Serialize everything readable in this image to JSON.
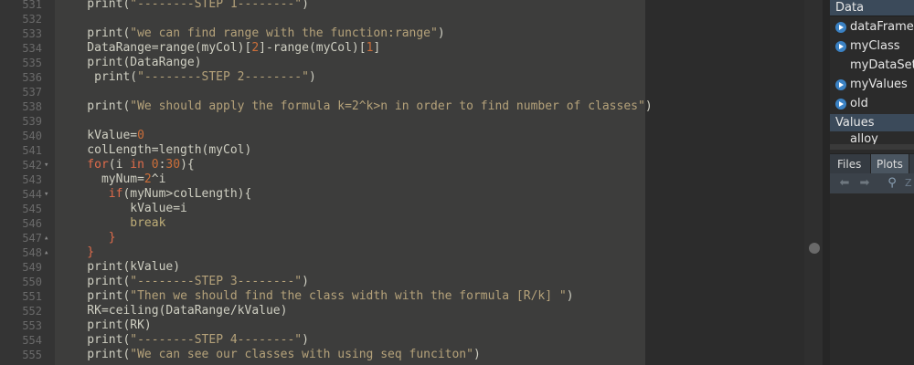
{
  "editor": {
    "lines": [
      {
        "num": "531",
        "fold": "",
        "segs": [
          {
            "c": "t",
            "x": "    print("
          },
          {
            "c": "s",
            "x": "\"--------STEP 1--------\""
          },
          {
            "c": "t",
            "x": ")"
          }
        ]
      },
      {
        "num": "532",
        "fold": "",
        "segs": []
      },
      {
        "num": "533",
        "fold": "",
        "segs": [
          {
            "c": "t",
            "x": "    print("
          },
          {
            "c": "s",
            "x": "\"we can find range with the function:range\""
          },
          {
            "c": "t",
            "x": ")"
          }
        ]
      },
      {
        "num": "534",
        "fold": "",
        "segs": [
          {
            "c": "t",
            "x": "    DataRange=range(myCol)["
          },
          {
            "c": "n",
            "x": "2"
          },
          {
            "c": "t",
            "x": "]-range(myCol)["
          },
          {
            "c": "n",
            "x": "1"
          },
          {
            "c": "t",
            "x": "]"
          }
        ]
      },
      {
        "num": "535",
        "fold": "",
        "segs": [
          {
            "c": "t",
            "x": "    print(DataRange)"
          }
        ]
      },
      {
        "num": "536",
        "fold": "",
        "segs": [
          {
            "c": "t",
            "x": "     print("
          },
          {
            "c": "s",
            "x": "\"--------STEP 2--------\""
          },
          {
            "c": "t",
            "x": ")"
          }
        ]
      },
      {
        "num": "537",
        "fold": "",
        "segs": []
      },
      {
        "num": "538",
        "fold": "",
        "segs": [
          {
            "c": "t",
            "x": "    print("
          },
          {
            "c": "s",
            "x": "\"We should apply the formula k=2^k>n in order to find number of classes\""
          },
          {
            "c": "t",
            "x": ")"
          }
        ]
      },
      {
        "num": "539",
        "fold": "",
        "segs": []
      },
      {
        "num": "540",
        "fold": "",
        "segs": [
          {
            "c": "t",
            "x": "    kValue="
          },
          {
            "c": "n",
            "x": "0"
          }
        ]
      },
      {
        "num": "541",
        "fold": "",
        "segs": [
          {
            "c": "t",
            "x": "    colLength=length(myCol)"
          }
        ]
      },
      {
        "num": "542",
        "fold": "▾",
        "segs": [
          {
            "c": "k",
            "x": "    for"
          },
          {
            "c": "t",
            "x": "(i "
          },
          {
            "c": "k",
            "x": "in"
          },
          {
            "c": "t",
            "x": " "
          },
          {
            "c": "n",
            "x": "0"
          },
          {
            "c": "t",
            "x": ":"
          },
          {
            "c": "n",
            "x": "30"
          },
          {
            "c": "t",
            "x": "){"
          }
        ]
      },
      {
        "num": "543",
        "fold": "",
        "segs": [
          {
            "c": "t",
            "x": "      myNum="
          },
          {
            "c": "n",
            "x": "2"
          },
          {
            "c": "t",
            "x": "^i"
          }
        ]
      },
      {
        "num": "544",
        "fold": "▾",
        "segs": [
          {
            "c": "k",
            "x": "       if"
          },
          {
            "c": "t",
            "x": "(myNum>colLength){"
          }
        ]
      },
      {
        "num": "545",
        "fold": "",
        "segs": [
          {
            "c": "t",
            "x": "          kValue=i"
          }
        ]
      },
      {
        "num": "546",
        "fold": "",
        "segs": [
          {
            "c": "b",
            "x": "          break"
          }
        ]
      },
      {
        "num": "547",
        "fold": "▴",
        "segs": [
          {
            "c": "k",
            "x": "       }"
          }
        ]
      },
      {
        "num": "548",
        "fold": "▴",
        "segs": [
          {
            "c": "k",
            "x": "    }"
          }
        ]
      },
      {
        "num": "549",
        "fold": "",
        "segs": [
          {
            "c": "t",
            "x": "    print(kValue)"
          }
        ]
      },
      {
        "num": "550",
        "fold": "",
        "segs": [
          {
            "c": "t",
            "x": "    print("
          },
          {
            "c": "s",
            "x": "\"--------STEP 3--------\""
          },
          {
            "c": "t",
            "x": ")"
          }
        ]
      },
      {
        "num": "551",
        "fold": "",
        "segs": [
          {
            "c": "t",
            "x": "    print("
          },
          {
            "c": "s",
            "x": "\"Then we should find the class width with the formula [R/k] \""
          },
          {
            "c": "t",
            "x": ")"
          }
        ]
      },
      {
        "num": "552",
        "fold": "",
        "segs": [
          {
            "c": "t",
            "x": "    RK=ceiling(DataRange/kValue)"
          }
        ]
      },
      {
        "num": "553",
        "fold": "",
        "segs": [
          {
            "c": "t",
            "x": "    print(RK)"
          }
        ]
      },
      {
        "num": "554",
        "fold": "",
        "segs": [
          {
            "c": "t",
            "x": "    print("
          },
          {
            "c": "s",
            "x": "\"--------STEP 4--------\""
          },
          {
            "c": "t",
            "x": ")"
          }
        ]
      },
      {
        "num": "555",
        "fold": "",
        "segs": [
          {
            "c": "t",
            "x": "    print("
          },
          {
            "c": "s",
            "x": "\"We can see our classes with using seq funciton\""
          },
          {
            "c": "t",
            "x": ")"
          }
        ]
      }
    ]
  },
  "environment": {
    "data_header": "Data",
    "items": [
      {
        "name": "dataFrame",
        "expand": true
      },
      {
        "name": "myClass",
        "expand": true
      },
      {
        "name": "myDataSet",
        "expand": false
      },
      {
        "name": "myValues",
        "expand": true
      },
      {
        "name": "old",
        "expand": true
      }
    ],
    "values_header": "Values",
    "values_first": "alloy"
  },
  "files_pane": {
    "tabs": [
      "Files",
      "Plots"
    ],
    "active_tab": "Plots",
    "zoom_label": "Z"
  }
}
